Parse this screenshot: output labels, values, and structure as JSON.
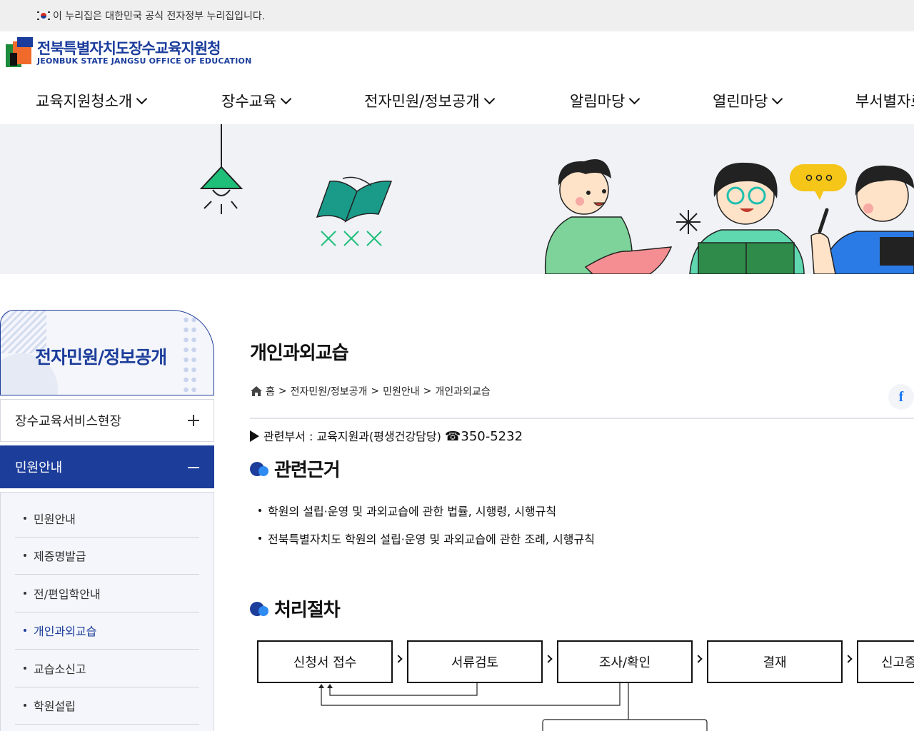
{
  "gov_banner": {
    "text": "이 누리집은 대한민국 공식 전자정부 누리집입니다."
  },
  "logo": {
    "name_ko": "전북특별자치도장수교육지원청",
    "name_en": "JEONBUK STATE JANGSU OFFICE OF EDUCATION"
  },
  "gnb": {
    "items": [
      {
        "label": "교육지원청소개"
      },
      {
        "label": "장수교육"
      },
      {
        "label": "전자민원/정보공개"
      },
      {
        "label": "알림마당"
      },
      {
        "label": "열린마당"
      },
      {
        "label": "부서별자료"
      }
    ]
  },
  "lnb": {
    "title": "전자민원/정보공개",
    "sections": [
      {
        "label": "장수교육서비스현장",
        "expanded": false
      },
      {
        "label": "민원안내",
        "expanded": true
      }
    ],
    "sub_items": [
      {
        "label": "민원안내"
      },
      {
        "label": "제증명발급"
      },
      {
        "label": "전/편입학안내"
      },
      {
        "label": "개인과외교습"
      },
      {
        "label": "교습소신고"
      },
      {
        "label": "학원설립"
      }
    ]
  },
  "content": {
    "title": "개인과외교습",
    "breadcrumb": {
      "home": "홈",
      "sep": ">",
      "level1": "전자민원/정보공개",
      "level2": "민원안내",
      "level3": "개인과외교습"
    },
    "dept_label": "관련부서 : 교육지원과(평생건강담당)",
    "dept_tel": "☎350-5232",
    "basis": {
      "heading": "관련근거",
      "items": [
        "학원의 설립·운영 및 과외교습에 관한 법률, 시행령, 시행규칙",
        "전북특별자치도 학원의 설립·운영 및 과외교습에 관한 조례, 시행규칙"
      ]
    },
    "process": {
      "heading": "처리절차",
      "steps": [
        "신청서 접수",
        "서류검토",
        "조사/확인",
        "결재",
        "신고증"
      ]
    }
  },
  "share": {
    "facebook": "f"
  },
  "colors": {
    "brand_blue": "#1c3d9a",
    "accent_blue": "#2f8af2",
    "banner_bg": "#f0f2f6"
  }
}
